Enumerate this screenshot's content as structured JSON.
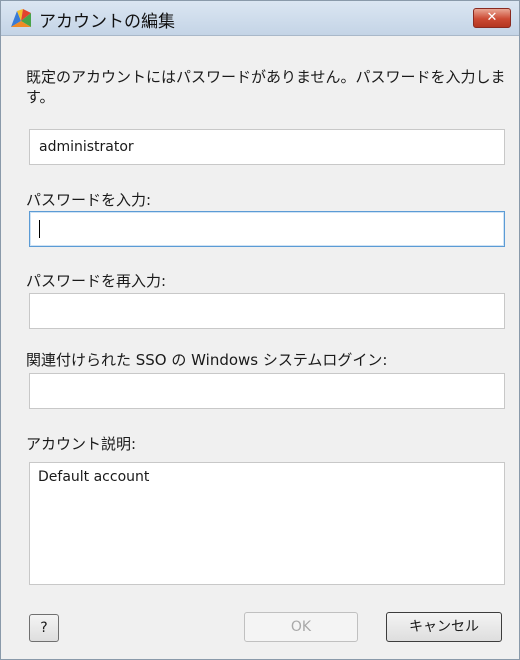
{
  "window": {
    "title": "アカウントの編集",
    "close_symbol": "✕"
  },
  "instruction": "既定のアカウントにはパスワードがありません。パスワードを入力します。",
  "account_name": {
    "value": "administrator"
  },
  "password": {
    "label": "パスワードを入力:",
    "value": ""
  },
  "password_confirm": {
    "label": "パスワードを再入力:",
    "value": ""
  },
  "sso_login": {
    "label": "関連付けられた SSO の Windows システムログイン:",
    "value": ""
  },
  "description": {
    "label": "アカウント説明:",
    "value": "Default account"
  },
  "buttons": {
    "help": "?",
    "ok": "OK",
    "cancel": "キャンセル"
  },
  "colors": {
    "titlebar": "#c4d4e6",
    "close_button": "#cc4a33",
    "focus_border": "#5b9bd5"
  }
}
